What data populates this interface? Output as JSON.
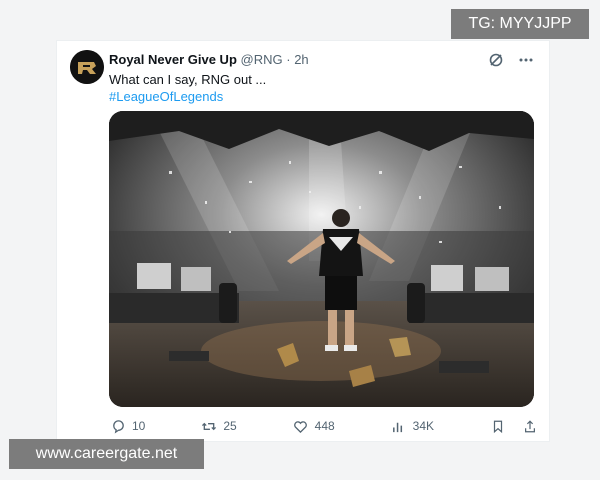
{
  "tweet": {
    "author_name": "Royal Never Give Up",
    "handle": "@RNG",
    "separator": "·",
    "time": "2h",
    "text": "What can I say, RNG out ...",
    "hashtag": "#LeagueOfLegends",
    "actions": {
      "replies": "10",
      "reposts": "25",
      "likes": "448",
      "views": "34K"
    }
  },
  "overlays": {
    "telegram_tag": "TG: MYYJJPP",
    "watermark": "www.careergate.net"
  },
  "colors": {
    "link": "#1d9bf0",
    "muted_text": "#536471",
    "overlay_bg": "#7c7c7c"
  },
  "icons": [
    "grok-icon",
    "more-icon",
    "reply-icon",
    "repost-icon",
    "like-icon",
    "views-icon",
    "bookmark-icon",
    "share-icon"
  ]
}
